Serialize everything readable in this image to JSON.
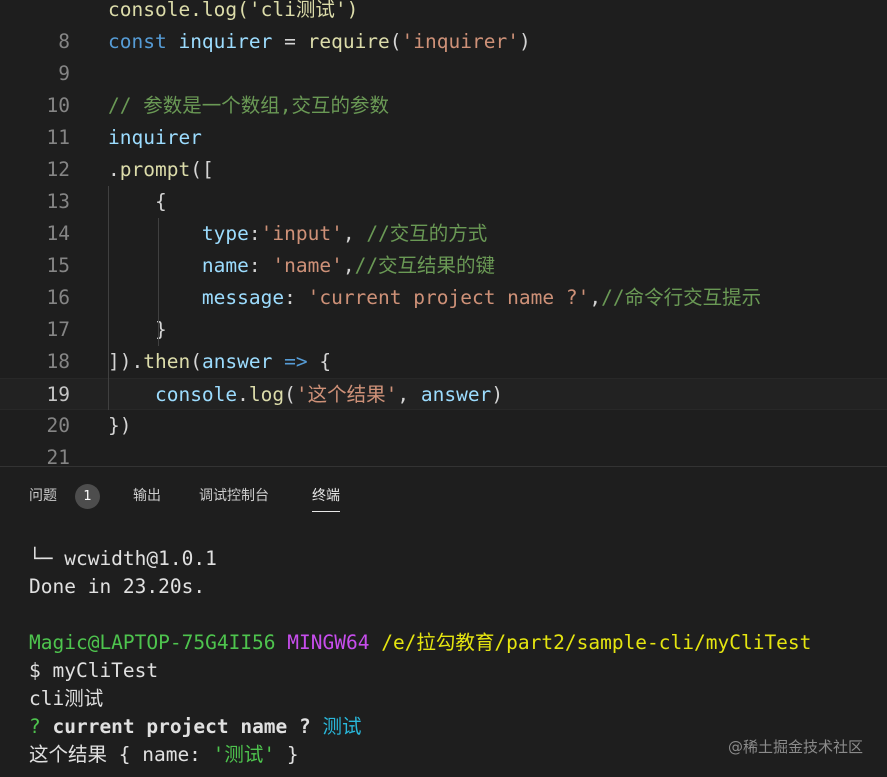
{
  "editor": {
    "lines": [
      {
        "num": "",
        "tokens": [
          {
            "c": "fn",
            "t": "console.log('cli测试')"
          }
        ]
      },
      {
        "num": "8",
        "tokens": [
          {
            "c": "kw",
            "t": "const "
          },
          {
            "c": "var",
            "t": "inquirer"
          },
          {
            "c": "pn",
            "t": " = "
          },
          {
            "c": "fn",
            "t": "require"
          },
          {
            "c": "pn",
            "t": "("
          },
          {
            "c": "str",
            "t": "'inquirer'"
          },
          {
            "c": "pn",
            "t": ")"
          }
        ]
      },
      {
        "num": "9",
        "tokens": []
      },
      {
        "num": "10",
        "tokens": [
          {
            "c": "cm",
            "t": "// 参数是一个数组,交互的参数"
          }
        ]
      },
      {
        "num": "11",
        "tokens": [
          {
            "c": "var",
            "t": "inquirer"
          }
        ]
      },
      {
        "num": "12",
        "tokens": [
          {
            "c": "pn",
            "t": "."
          },
          {
            "c": "fn",
            "t": "prompt"
          },
          {
            "c": "pn",
            "t": "(["
          }
        ]
      },
      {
        "num": "13",
        "tokens": [
          {
            "c": "pn",
            "t": "    {"
          }
        ]
      },
      {
        "num": "14",
        "tokens": [
          {
            "c": "pn",
            "t": "        "
          },
          {
            "c": "var",
            "t": "type"
          },
          {
            "c": "pn",
            "t": ":"
          },
          {
            "c": "str",
            "t": "'input'"
          },
          {
            "c": "pn",
            "t": ", "
          },
          {
            "c": "cm",
            "t": "//交互的方式"
          }
        ]
      },
      {
        "num": "15",
        "tokens": [
          {
            "c": "pn",
            "t": "        "
          },
          {
            "c": "var",
            "t": "name"
          },
          {
            "c": "pn",
            "t": ": "
          },
          {
            "c": "str",
            "t": "'name'"
          },
          {
            "c": "pn",
            "t": ","
          },
          {
            "c": "cm",
            "t": "//交互结果的键"
          }
        ]
      },
      {
        "num": "16",
        "tokens": [
          {
            "c": "pn",
            "t": "        "
          },
          {
            "c": "var",
            "t": "message"
          },
          {
            "c": "pn",
            "t": ": "
          },
          {
            "c": "str",
            "t": "'current project name ?'"
          },
          {
            "c": "pn",
            "t": ","
          },
          {
            "c": "cm",
            "t": "//命令行交互提示"
          }
        ]
      },
      {
        "num": "17",
        "tokens": [
          {
            "c": "pn",
            "t": "    }"
          }
        ]
      },
      {
        "num": "18",
        "tokens": [
          {
            "c": "pn",
            "t": "])."
          },
          {
            "c": "fn",
            "t": "then"
          },
          {
            "c": "pn",
            "t": "("
          },
          {
            "c": "var",
            "t": "answer"
          },
          {
            "c": "pn",
            "t": " "
          },
          {
            "c": "kw",
            "t": "=>"
          },
          {
            "c": "pn",
            "t": " {"
          }
        ]
      },
      {
        "num": "19",
        "current": true,
        "tokens": [
          {
            "c": "pn",
            "t": "    "
          },
          {
            "c": "var",
            "t": "console"
          },
          {
            "c": "pn",
            "t": "."
          },
          {
            "c": "fn",
            "t": "log"
          },
          {
            "c": "pn",
            "t": "("
          },
          {
            "c": "str",
            "t": "'这个结果'"
          },
          {
            "c": "pn",
            "t": ", "
          },
          {
            "c": "var",
            "t": "answer"
          },
          {
            "c": "pn",
            "t": ")"
          }
        ]
      },
      {
        "num": "20",
        "tokens": [
          {
            "c": "pn",
            "t": "})"
          }
        ]
      },
      {
        "num": "21",
        "tokens": []
      }
    ]
  },
  "panel": {
    "tabs": [
      {
        "label": "问题",
        "active": false
      },
      {
        "label": "输出",
        "active": false
      },
      {
        "label": "调试控制台",
        "active": false
      },
      {
        "label": "终端",
        "active": true
      }
    ],
    "problems_count": "1"
  },
  "terminal": {
    "lines": [
      [
        {
          "c": "t-default",
          "t": "└─ wcwidth@1.0.1"
        }
      ],
      [
        {
          "c": "t-default",
          "t": "Done in 23.20s."
        }
      ],
      [],
      [
        {
          "c": "t-green",
          "t": "Magic@LAPTOP-75G4II56 "
        },
        {
          "c": "t-magenta",
          "t": "MINGW64 "
        },
        {
          "c": "t-yellow",
          "t": "/e/拉勾教育/part2/sample-cli/myCliTest"
        }
      ],
      [
        {
          "c": "t-default",
          "t": "$ myCliTest"
        }
      ],
      [
        {
          "c": "t-default",
          "t": "cli测试"
        }
      ],
      [
        {
          "c": "t-green",
          "t": "? "
        },
        {
          "c": "t-default t-bold",
          "t": "current project name ? "
        },
        {
          "c": "t-cyan",
          "t": "测试"
        }
      ],
      [
        {
          "c": "t-default",
          "t": "这个结果 { name: "
        },
        {
          "c": "t-green",
          "t": "'测试'"
        },
        {
          "c": "t-default",
          "t": " }"
        }
      ]
    ]
  },
  "watermark": "@稀土掘金技术社区"
}
